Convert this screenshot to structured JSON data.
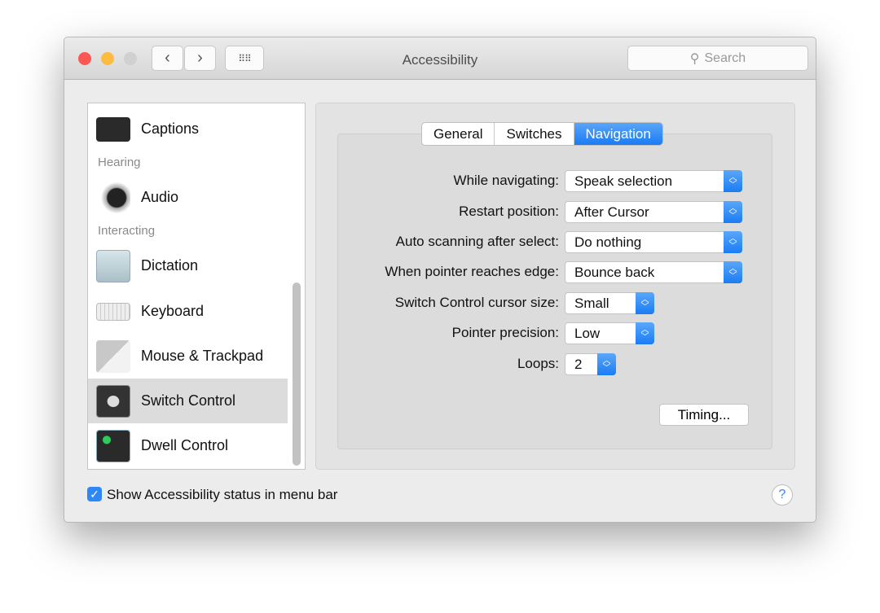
{
  "window": {
    "title": "Accessibility",
    "search_placeholder": "Search"
  },
  "sidebar": {
    "items": [
      {
        "label": "Captions",
        "icon": "captions-icon"
      },
      {
        "header": "Hearing"
      },
      {
        "label": "Audio",
        "icon": "speaker-icon"
      },
      {
        "header": "Interacting"
      },
      {
        "label": "Dictation",
        "icon": "microphone-icon"
      },
      {
        "label": "Keyboard",
        "icon": "keyboard-icon"
      },
      {
        "label": "Mouse & Trackpad",
        "icon": "mouse-icon"
      },
      {
        "label": "Switch Control",
        "icon": "switch-control-icon",
        "selected": true
      },
      {
        "label": "Dwell Control",
        "icon": "dwell-control-icon"
      }
    ]
  },
  "tabs": [
    "General",
    "Switches",
    "Navigation"
  ],
  "active_tab": "Navigation",
  "settings": [
    {
      "label": "While navigating:",
      "value": "Speak selection"
    },
    {
      "label": "Restart position:",
      "value": "After Cursor"
    },
    {
      "label": "Auto scanning after select:",
      "value": "Do nothing"
    },
    {
      "label": "When pointer reaches edge:",
      "value": "Bounce back"
    },
    {
      "label": "Switch Control cursor size:",
      "value": "Small"
    },
    {
      "label": "Pointer precision:",
      "value": "Low"
    },
    {
      "label": "Loops:",
      "value": "2"
    }
  ],
  "timing_button": "Timing...",
  "footer": {
    "checkbox_label": "Show Accessibility status in menu bar",
    "checked": true,
    "help": "?"
  },
  "colors": {
    "accent": "#1a7cf3",
    "close": "#fc5753",
    "minimize": "#fdbc40"
  }
}
